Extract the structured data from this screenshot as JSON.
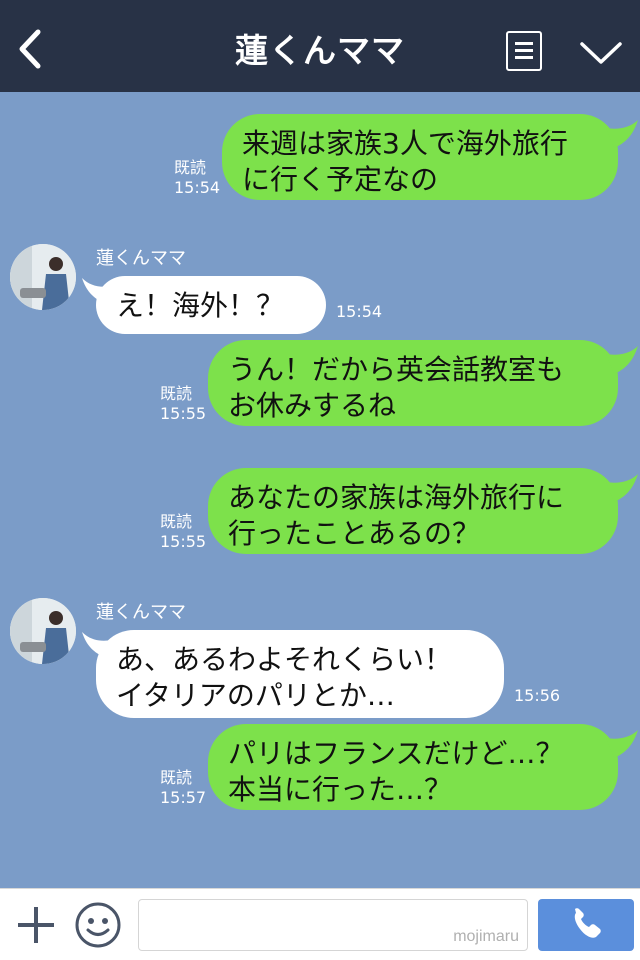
{
  "header": {
    "title": "蓮くんママ",
    "back_icon": "back-arrow-icon",
    "menu_icon": "menu-list-icon",
    "collapse_icon": "chevron-down-icon",
    "background": "#283246"
  },
  "chat": {
    "background": "#7b9cc8",
    "bubble_out_color": "#7de14b",
    "bubble_in_color": "#ffffff",
    "messages": [
      {
        "direction": "out",
        "text": "来週は家族3人で海外旅行\nに行く予定なの",
        "read": "既読",
        "time": "15:54"
      },
      {
        "direction": "in",
        "sender": "蓮くんママ",
        "text": "え！海外！？",
        "time": "15:54"
      },
      {
        "direction": "out",
        "text": "うん！だから英会話教室も\nお休みするね",
        "read": "既読",
        "time": "15:55"
      },
      {
        "direction": "out",
        "text": "あなたの家族は海外旅行に\n行ったことあるの？",
        "read": "既読",
        "time": "15:55"
      },
      {
        "direction": "in",
        "sender": "蓮くんママ",
        "text": "あ、あるわよそれくらい！\nイタリアのパリとか…",
        "time": "15:56"
      },
      {
        "direction": "out",
        "text": "パリはフランスだけど…？\n本当に行った…？",
        "read": "既読",
        "time": "15:57"
      }
    ]
  },
  "footer": {
    "plus_icon": "plus-icon",
    "emoji_icon": "emoji-icon",
    "input_value": "",
    "watermark": "mojimaru",
    "call_icon": "phone-icon",
    "call_color": "#5b8fdc"
  }
}
